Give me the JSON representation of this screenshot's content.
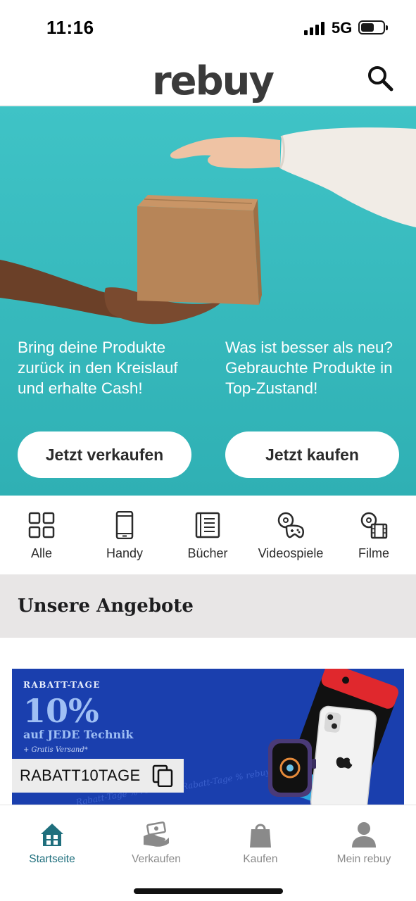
{
  "status_bar": {
    "time": "11:16",
    "network": "5G",
    "signal_bars": 4,
    "battery_level": 0.6
  },
  "header": {
    "logo": "rebuy",
    "search_icon": "search-icon"
  },
  "hero": {
    "background_color": "#3fc3c6",
    "left": {
      "text": "Bring deine Produkte zurück in den Kreislauf und erhalte Cash!",
      "button_label": "Jetzt verkaufen"
    },
    "right": {
      "text": "Was ist besser als neu? Gebrauchte Produkte in Top-Zustand!",
      "button_label": "Jetzt kaufen"
    }
  },
  "categories": [
    {
      "label": "Alle",
      "icon": "grid-icon"
    },
    {
      "label": "Handy",
      "icon": "phone-icon"
    },
    {
      "label": "Bücher",
      "icon": "book-icon"
    },
    {
      "label": "Videospiele",
      "icon": "gamepad-icon"
    },
    {
      "label": "Filme",
      "icon": "film-icon"
    }
  ],
  "section": {
    "title": "Unsere Angebote"
  },
  "promo": {
    "background_color": "#1a3fae",
    "kicker": "RABATT-TAGE",
    "headline": "10%",
    "subline": "auf JEDE Technik",
    "note": "+ Gratis Versand*",
    "coupon_code": "RABATT10TAGE",
    "watermark": "Rabatt-Tage % rebuy"
  },
  "bottom_nav": {
    "active_color": "#1f6f7d",
    "items": [
      {
        "label": "Startseite",
        "icon": "home-icon",
        "active": true
      },
      {
        "label": "Verkaufen",
        "icon": "sell-hand-icon",
        "active": false
      },
      {
        "label": "Kaufen",
        "icon": "shopping-bag-icon",
        "active": false
      },
      {
        "label": "Mein rebuy",
        "icon": "user-icon",
        "active": false
      }
    ]
  }
}
